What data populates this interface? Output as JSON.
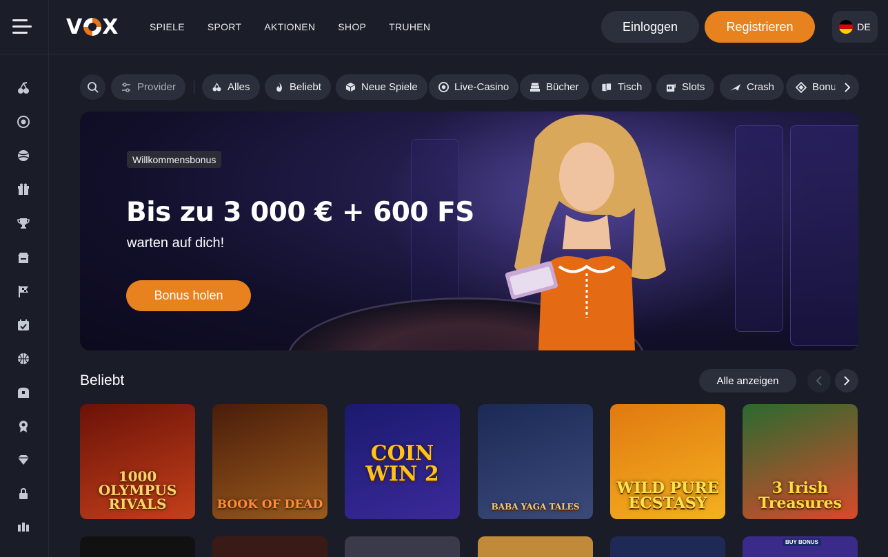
{
  "header": {
    "logo": "VOX",
    "nav": [
      "SPIELE",
      "SPORT",
      "AKTIONEN",
      "SHOP",
      "TRUHEN"
    ],
    "login_label": "Einloggen",
    "register_label": "Registrieren",
    "language": "DE"
  },
  "sidebar": {
    "icons": [
      "cherries-icon",
      "roulette-icon",
      "sports-ball-icon",
      "gift-icon",
      "trophy-icon",
      "shop-icon",
      "flag-icon",
      "calendar-icon",
      "basketball-icon",
      "treasure-chest-icon",
      "badge-icon",
      "diamond-icon",
      "lock-icon",
      "bars-icon"
    ]
  },
  "categories": {
    "provider_label": "Provider",
    "items": [
      {
        "label": "Alles",
        "icon": "cherries-icon"
      },
      {
        "label": "Beliebt",
        "icon": "fire-icon"
      },
      {
        "label": "Neue Spiele",
        "icon": "cube-icon"
      },
      {
        "label": "Live-Casino",
        "icon": "chip-icon"
      },
      {
        "label": "Bücher",
        "icon": "books-icon"
      },
      {
        "label": "Tisch",
        "icon": "cards-icon"
      },
      {
        "label": "Slots",
        "icon": "slots-icon"
      },
      {
        "label": "Crash",
        "icon": "plane-icon"
      },
      {
        "label": "Bonus",
        "icon": "diamond-icon"
      }
    ]
  },
  "banner": {
    "badge": "Willkommensbonus",
    "headline": "Bis zu 3 000 € + 600 FS",
    "subline": "warten auf dich!",
    "cta_label": "Bonus holen",
    "slide_count": 11,
    "active_slide": 1
  },
  "popular": {
    "title": "Beliebt",
    "show_all_label": "Alle anzeigen",
    "games": [
      {
        "name": "1000 OLYMPUS RIVALS",
        "colors": [
          "#6b1208",
          "#c4401a"
        ]
      },
      {
        "name": "BOOK OF DEAD",
        "colors": [
          "#4a1d0a",
          "#9a5a1c"
        ]
      },
      {
        "name": "COIN WIN 2",
        "colors": [
          "#1a1a6e",
          "#3b2a9a"
        ]
      },
      {
        "name": "BABA YAGA TALES",
        "colors": [
          "#1a2a55",
          "#3c4a7a"
        ]
      },
      {
        "name": "WILD PURE ECSTASY",
        "colors": [
          "#e07a10",
          "#f5b020"
        ]
      },
      {
        "name": "3 Irish Treasures",
        "colors": [
          "#2a6a30",
          "#d94a2a"
        ]
      }
    ],
    "row2_badge": "BUY BONUS"
  }
}
